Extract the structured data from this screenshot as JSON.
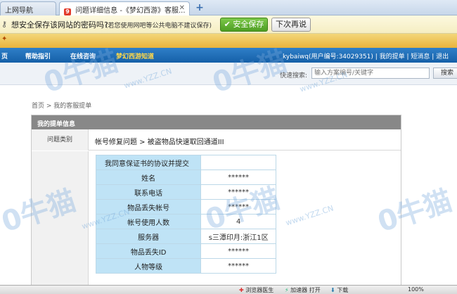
{
  "tabs": [
    {
      "label": "上网导航",
      "active": false
    },
    {
      "label": "问题详细信息 -《梦幻西游》客服...",
      "active": true
    }
  ],
  "password_bar": {
    "question": "想安全保存该网站的密码吗?",
    "hint": "(若您使用网吧等公共电脑不建议保存)",
    "save_label": "安全保存",
    "later_label": "下次再说"
  },
  "nav": {
    "items": [
      "页",
      "帮助指引",
      "在线咨询",
      "梦幻西游知道"
    ],
    "user_info": "kybaiwq(用户编号:34029351) | 我的提单 | 短消息 | 退出"
  },
  "search": {
    "label": "快速搜索:",
    "placeholder": "输入方案编号/关键字",
    "button_label": "搜索"
  },
  "breadcrumb": "首页 > 我的客服提单",
  "panel": {
    "title": "我的提单信息",
    "category_label": "问题类别",
    "category_value": "帐号修复问题 > 被盗物品快速取回通道III"
  },
  "form": {
    "agree_label": "我同意保证书的协议并提交",
    "rows": [
      {
        "k": "姓名",
        "v": "******"
      },
      {
        "k": "联系电话",
        "v": "******"
      },
      {
        "k": "物品丢失帐号",
        "v": "******"
      },
      {
        "k": "帐号使用人数",
        "v": "4"
      },
      {
        "k": "服务器",
        "v": "s三潭印月:浙江1区"
      },
      {
        "k": "物品丢失ID",
        "v": "******"
      },
      {
        "k": "人物等级",
        "v": "******"
      }
    ]
  },
  "watermark": {
    "big": "0牛猫",
    "small": "www.YZZ.CN"
  },
  "status": {
    "left": "浏览器医生",
    "accel": "加速器",
    "open": "打开",
    "download": "下载",
    "zoom": "100%"
  }
}
